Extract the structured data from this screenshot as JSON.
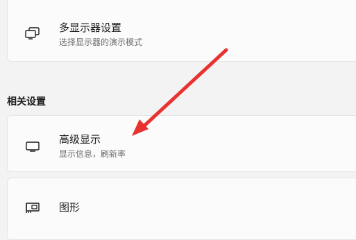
{
  "cards": [
    {
      "title": "多显示器设置",
      "subtitle": "选择显示器的演示模式",
      "icon": "multi-display-icon"
    },
    {
      "title": "高级显示",
      "subtitle": "显示信息，刷新率",
      "icon": "monitor-icon"
    },
    {
      "title": "图形",
      "icon": "graphics-card-icon"
    }
  ],
  "section_heading": "相关设置",
  "colors": {
    "page_bg": "#f3f3f3",
    "card_bg": "#fbfbfb",
    "annotation_arrow": "#e8322f"
  }
}
